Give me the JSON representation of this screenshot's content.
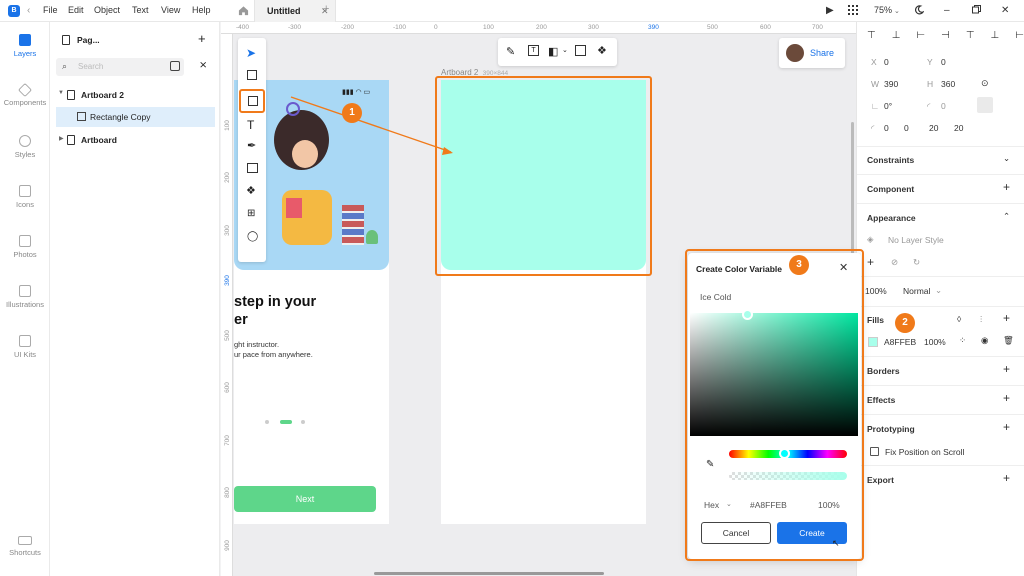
{
  "topbar": {
    "menus": [
      "File",
      "Edit",
      "Object",
      "Text",
      "View",
      "Help"
    ],
    "tab_title": "Untitled",
    "zoom": "75%"
  },
  "rail": {
    "items": [
      "Layers",
      "Components",
      "Styles",
      "Icons",
      "Photos",
      "Illustrations",
      "UI Kits"
    ],
    "shortcuts": "Shortcuts"
  },
  "layers": {
    "page_label": "Pag...",
    "search_placeholder": "Search",
    "tree": [
      "Artboard 2",
      "Rectangle Copy",
      "Artboard"
    ]
  },
  "canvas": {
    "ruler_h": [
      "-400",
      "-300",
      "-200",
      "-100",
      "0",
      "100",
      "200",
      "300",
      "390",
      "500",
      "600",
      "700"
    ],
    "ruler_v": [
      "100",
      "200",
      "300",
      "390",
      "500",
      "600",
      "700",
      "800",
      "900"
    ],
    "artboard_label": "Artboard 2",
    "artboard_size": "390×844",
    "share_label": "Share",
    "phone": {
      "headline": "step in your",
      "headline2": "er",
      "sub1": "ght instructor.",
      "sub2": "ur pace from anywhere.",
      "next_label": "Next"
    },
    "rect_fill": "#A8FFEB"
  },
  "right": {
    "x_label": "X",
    "x": "0",
    "y_label": "Y",
    "y": "0",
    "w_label": "W",
    "w": "390",
    "h_label": "H",
    "h": "360",
    "rotation": "0°",
    "radius": "0",
    "corners": [
      "0",
      "0",
      "20",
      "20"
    ],
    "constraints": "Constraints",
    "component": "Component",
    "appearance": "Appearance",
    "layer_style": "No Layer Style",
    "opacity": "100%",
    "blend": "Normal",
    "fills": "Fills",
    "fill_hex": "A8FFEB",
    "fill_opacity": "100%",
    "borders": "Borders",
    "effects": "Effects",
    "prototyping": "Prototyping",
    "fix_position": "Fix Position on Scroll",
    "export": "Export"
  },
  "modal": {
    "title": "Create Color Variable",
    "name_value": "Ice Cold",
    "mode": "Hex",
    "hex": "#A8FFEB",
    "alpha": "100%",
    "cancel": "Cancel",
    "create": "Create"
  },
  "badges": [
    "1",
    "2",
    "3"
  ],
  "colors": {
    "accent": "#1a73e8",
    "fill": "#A8FFEB",
    "highlight": "#f07a1a",
    "next_button": "#5ed68a"
  }
}
